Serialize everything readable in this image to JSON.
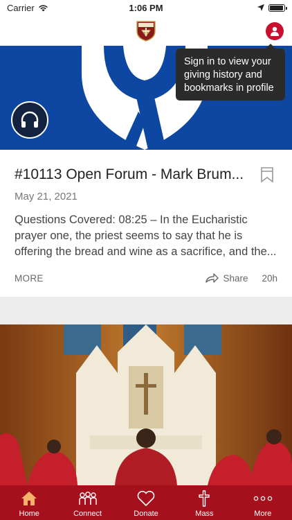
{
  "status_bar": {
    "carrier": "Carrier",
    "time": "1:06 PM",
    "battery_level": 0.95
  },
  "header": {
    "logo_icon": "parish-crest-logo",
    "profile_icon": "user-icon"
  },
  "tooltip": {
    "text": "Sign in to view your giving history and bookmarks in profile"
  },
  "feed": {
    "item1": {
      "title": "#10113 Open Forum - Mark Brum...",
      "date": "May 21, 2021",
      "description": "Questions Covered: 08:25 – In the Eucharistic prayer one, the priest seems to say that he is offering the bread and wine as a sacrifice, and the...",
      "more_label": "MORE",
      "share_label": "Share",
      "age": "20h",
      "media_icon": "headphones-icon",
      "banner_color": "#0d47a1"
    }
  },
  "tabs": [
    {
      "label": "Home",
      "icon": "home-icon"
    },
    {
      "label": "Connect",
      "icon": "people-icon"
    },
    {
      "label": "Donate",
      "icon": "heart-icon"
    },
    {
      "label": "Mass",
      "icon": "cross-icon"
    },
    {
      "label": "More",
      "icon": "more-dots-icon"
    }
  ],
  "colors": {
    "brand_red": "#a60f1c",
    "banner_blue": "#0d47a1",
    "tooltip_bg": "#2b2b2b"
  }
}
